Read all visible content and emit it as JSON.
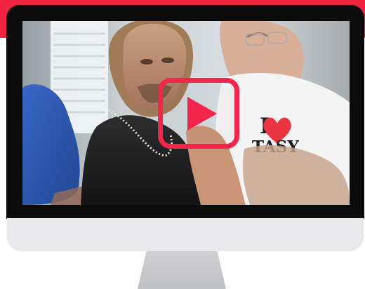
{
  "colors": {
    "accent": "#f0243f",
    "monitor_frame": "#0b0b0b",
    "monitor_chin": "#e9e9eb",
    "play_button": "#f2264a"
  },
  "video": {
    "shirt_text": "TASY",
    "shirt_text_prefix": "I",
    "play_icon": "play-icon"
  }
}
